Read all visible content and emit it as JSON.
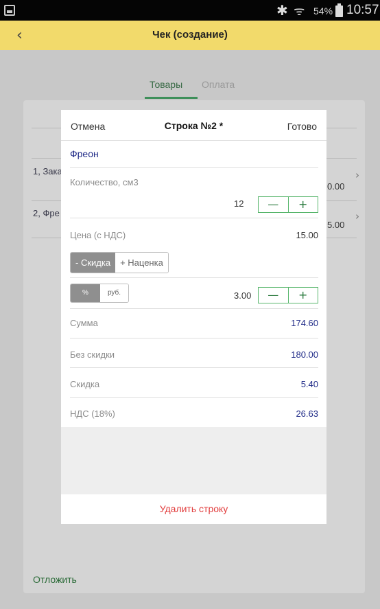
{
  "statusbar": {
    "bluetooth": "✱",
    "wifi": "ᯤ",
    "battery_percent": "54%",
    "time": "10:57"
  },
  "header": {
    "back_icon": "chevron-left",
    "title": "Чек (создание)"
  },
  "tabs": [
    {
      "label": "Товары",
      "active": true
    },
    {
      "label": "Оплата",
      "active": false
    }
  ],
  "list": {
    "rows": [
      {
        "label": "1, Зака",
        "amount": "0.00"
      },
      {
        "label": "2, Фре",
        "amount": "5.00"
      }
    ],
    "postpone_label": "Отложить"
  },
  "dialog": {
    "cancel_label": "Отмена",
    "title": "Строка №2 *",
    "done_label": "Готово",
    "product_name": "Фреон",
    "quantity": {
      "label": "Количество, см3",
      "value": "12",
      "minus": "—",
      "plus": "+"
    },
    "price": {
      "label": "Цена (с НДС)",
      "value": "15.00"
    },
    "discount_mode": {
      "options": [
        "- Скидка",
        "+ Наценка"
      ],
      "selected": "- Скидка"
    },
    "discount_unit": {
      "options": [
        "%",
        "руб."
      ],
      "selected": "%"
    },
    "discount_value": {
      "value": "3.00",
      "minus": "—",
      "plus": "+"
    },
    "totals": [
      {
        "label": "Сумма",
        "value": "174.60"
      },
      {
        "label": "Без скидки",
        "value": "180.00"
      },
      {
        "label": "Скидка",
        "value": "5.40"
      },
      {
        "label": "НДС (18%)",
        "value": "26.63"
      }
    ],
    "delete_label": "Удалить строку"
  },
  "colors": {
    "header_bg": "#f2da6b",
    "accent_green": "#3e8f5a",
    "value_blue": "#1f2a87",
    "delete_red": "#e13b3b"
  }
}
